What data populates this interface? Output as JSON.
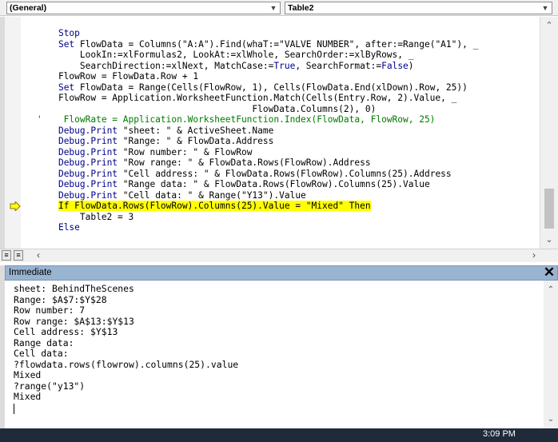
{
  "toolbar": {
    "object_dropdown": "(General)",
    "procedure_dropdown": "Table2"
  },
  "code": {
    "lines": [
      {
        "segments": [
          {
            "t": "    ",
            "c": ""
          },
          {
            "t": "Stop",
            "c": "kw"
          }
        ]
      },
      {
        "segments": [
          {
            "t": "    ",
            "c": ""
          },
          {
            "t": "Set",
            "c": "kw"
          },
          {
            "t": " FlowData = Columns(\"A:A\").Find(whaT:=\"VALVE NUMBER\", after:=Range(\"A1\"), _",
            "c": ""
          }
        ]
      },
      {
        "segments": [
          {
            "t": "        LookIn:=xlFormulas2, LookAt:=xlWhole, SearchOrder:=xlByRows, _",
            "c": ""
          }
        ]
      },
      {
        "segments": [
          {
            "t": "        SearchDirection:=xlNext, MatchCase:=",
            "c": ""
          },
          {
            "t": "True",
            "c": "kw"
          },
          {
            "t": ", SearchFormat:=",
            "c": ""
          },
          {
            "t": "False",
            "c": "kw"
          },
          {
            "t": ")",
            "c": ""
          }
        ]
      },
      {
        "segments": [
          {
            "t": "    FlowRow = FlowData.Row + 1",
            "c": ""
          }
        ]
      },
      {
        "segments": [
          {
            "t": "    ",
            "c": ""
          },
          {
            "t": "Set",
            "c": "kw"
          },
          {
            "t": " FlowData = Range(Cells(FlowRow, 1), Cells(FlowData.End(xlDown).Row, 25))",
            "c": ""
          }
        ]
      },
      {
        "segments": [
          {
            "t": "    FlowRow = Application.WorksheetFunction.Match(Cells(Entry.Row, 2).Value, _",
            "c": ""
          }
        ]
      },
      {
        "segments": [
          {
            "t": "                                        FlowData.Columns(2), 0)",
            "c": ""
          }
        ]
      },
      {
        "segments": [
          {
            "t": "'    FlowRate = Application.WorksheetFunction.Index(FlowData, FlowRow, 25)",
            "c": "cm"
          }
        ]
      },
      {
        "segments": [
          {
            "t": "    ",
            "c": ""
          },
          {
            "t": "Debug.Print",
            "c": "kw"
          },
          {
            "t": " \"sheet: \" & ActiveSheet.Name",
            "c": ""
          }
        ]
      },
      {
        "segments": [
          {
            "t": "    ",
            "c": ""
          },
          {
            "t": "Debug.Print",
            "c": "kw"
          },
          {
            "t": " \"Range: \" & FlowData.Address",
            "c": ""
          }
        ]
      },
      {
        "segments": [
          {
            "t": "    ",
            "c": ""
          },
          {
            "t": "Debug.Print",
            "c": "kw"
          },
          {
            "t": " \"Row number: \" & FlowRow",
            "c": ""
          }
        ]
      },
      {
        "segments": [
          {
            "t": "    ",
            "c": ""
          },
          {
            "t": "Debug.Print",
            "c": "kw"
          },
          {
            "t": " \"Row range: \" & FlowData.Rows(FlowRow).Address",
            "c": ""
          }
        ]
      },
      {
        "segments": [
          {
            "t": "    ",
            "c": ""
          },
          {
            "t": "Debug.Print",
            "c": "kw"
          },
          {
            "t": " \"Cell address: \" & FlowData.Rows(FlowRow).Columns(25).Address",
            "c": ""
          }
        ]
      },
      {
        "segments": [
          {
            "t": "    ",
            "c": ""
          },
          {
            "t": "Debug.Print",
            "c": "kw"
          },
          {
            "t": " \"Range data: \" & FlowData.Rows(FlowRow).Columns(25).Value",
            "c": ""
          }
        ]
      },
      {
        "segments": [
          {
            "t": "    ",
            "c": ""
          },
          {
            "t": "Debug.Print",
            "c": "kw"
          },
          {
            "t": " \"Cell data: \" & Range(\"Y13\").Value",
            "c": ""
          }
        ]
      },
      {
        "segments": [
          {
            "t": "    ",
            "c": ""
          },
          {
            "t": "If FlowData.Rows(FlowRow).Columns(25).Value = \"Mixed\" Then",
            "c": "hl"
          }
        ]
      },
      {
        "segments": [
          {
            "t": "        Table2 = 3",
            "c": ""
          }
        ]
      },
      {
        "segments": [
          {
            "t": "    ",
            "c": ""
          },
          {
            "t": "Else",
            "c": "kw"
          }
        ]
      }
    ]
  },
  "immediate": {
    "title": "Immediate",
    "lines": [
      "sheet: BehindTheScenes",
      "Range: $A$7:$Y$28",
      "Row number: 7",
      "Row range: $A$13:$Y$13",
      "Cell address: $Y$13",
      "Range data:",
      "Cell data:",
      "?flowdata.rows(flowrow).columns(25).value",
      "Mixed",
      "?range(\"y13\")",
      "Mixed"
    ]
  },
  "taskbar": {
    "clock": "3:09 PM"
  },
  "colors": {
    "keyword": "#00008b",
    "comment": "#007a00",
    "highlight": "#ffff00",
    "immediate_title_bg": "#99b4d1"
  },
  "icons": [
    "chevron-down-icon",
    "execution-arrow-icon",
    "close-icon",
    "scroll-up-icon",
    "scroll-down-icon",
    "scroll-left-icon",
    "scroll-right-icon"
  ]
}
